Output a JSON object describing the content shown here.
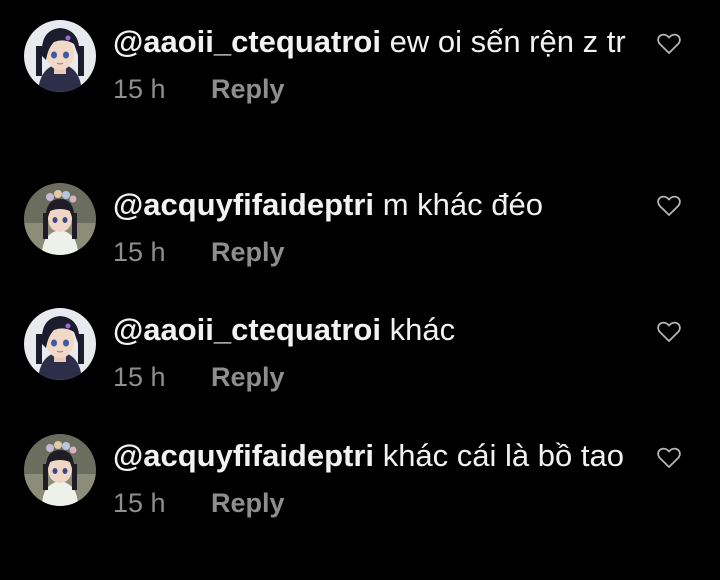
{
  "comments": [
    {
      "username": "@aaoii_ctequatroi",
      "text": "ew oi sến rện z tr",
      "time": "15 h",
      "reply": "Reply"
    },
    {
      "username": "@acquyfifaideptri",
      "text": "m khác đéo",
      "time": "15 h",
      "reply": "Reply"
    },
    {
      "username": "@aaoii_ctequatroi",
      "text": "khác",
      "time": "15 h",
      "reply": "Reply"
    },
    {
      "username": "@acquyfifaideptri",
      "text": "khác cái là bồ tao",
      "time": "15 h",
      "reply": "Reply"
    }
  ],
  "colors": {
    "background": "#000000",
    "text": "#f2f2f2",
    "muted": "#8e8e8e"
  },
  "icons": {
    "like": "heart-outline-icon",
    "avatar_1": "anime-avatar-dark-hair",
    "avatar_2": "anime-avatar-flower-crown"
  }
}
